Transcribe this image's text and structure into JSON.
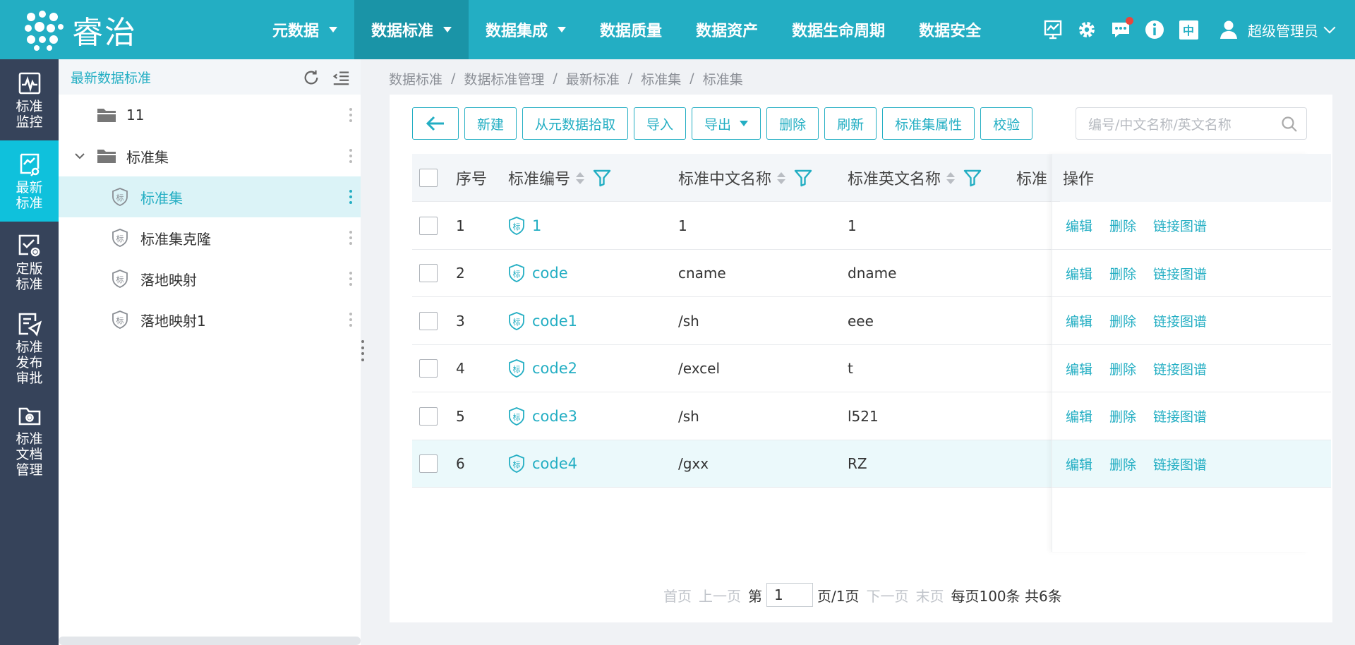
{
  "app": {
    "logo_text": "睿治"
  },
  "nav": [
    {
      "label": "元数据",
      "dropdown": true,
      "active": false
    },
    {
      "label": "数据标准",
      "dropdown": true,
      "active": true
    },
    {
      "label": "数据集成",
      "dropdown": true,
      "active": false
    },
    {
      "label": "数据质量",
      "dropdown": false,
      "active": false
    },
    {
      "label": "数据资产",
      "dropdown": false,
      "active": false
    },
    {
      "label": "数据生命周期",
      "dropdown": false,
      "active": false
    },
    {
      "label": "数据安全",
      "dropdown": false,
      "active": false
    }
  ],
  "tools": {
    "lang": "中",
    "user": "超级管理员"
  },
  "rail": [
    {
      "label": "标准监控",
      "icon": "monitor-pulse-icon",
      "active": false
    },
    {
      "label": "最新标准",
      "icon": "chart-doc-icon",
      "active": true
    },
    {
      "label": "定版标准",
      "icon": "check-gear-icon",
      "active": false
    },
    {
      "label": "标准发布审批",
      "icon": "doc-send-icon",
      "active": false
    },
    {
      "label": "标准文档管理",
      "icon": "folder-gear-icon",
      "active": false
    }
  ],
  "tree": {
    "title": "最新数据标准",
    "nodes": [
      {
        "label": "11",
        "type": "folder"
      },
      {
        "label": "标准集",
        "type": "folder-expanded"
      },
      {
        "label": "标准集",
        "type": "standard",
        "selected": true
      },
      {
        "label": "标准集克隆",
        "type": "standard"
      },
      {
        "label": "落地映射",
        "type": "standard"
      },
      {
        "label": "落地映射1",
        "type": "standard"
      }
    ]
  },
  "breadcrumb": [
    "数据标准",
    "数据标准管理",
    "最新标准",
    "标准集",
    "标准集"
  ],
  "toolbar": {
    "new": "新建",
    "pick": "从元数据拾取",
    "import": "导入",
    "export": "导出",
    "delete": "删除",
    "refresh": "刷新",
    "props": "标准集属性",
    "validate": "校验"
  },
  "search": {
    "placeholder": "编号/中文名称/英文名称"
  },
  "table": {
    "headers": {
      "seq": "序号",
      "code": "标准编号",
      "cname": "标准中文名称",
      "ename": "标准英文名称",
      "more": "标准",
      "ops": "操作"
    },
    "rows": [
      {
        "seq": "1",
        "code": "1",
        "cname": "1",
        "ename": "1"
      },
      {
        "seq": "2",
        "code": "code",
        "cname": "cname",
        "ename": "dname"
      },
      {
        "seq": "3",
        "code": "code1",
        "cname": "/sh",
        "ename": "eee"
      },
      {
        "seq": "4",
        "code": "code2",
        "cname": "/excel",
        "ename": "t"
      },
      {
        "seq": "5",
        "code": "code3",
        "cname": "/sh",
        "ename": "l521"
      },
      {
        "seq": "6",
        "code": "code4",
        "cname": "/gxx",
        "ename": "RZ"
      }
    ],
    "row_actions": {
      "edit": "编辑",
      "delete": "删除",
      "graph": "链接图谱"
    },
    "shield_glyph": "标"
  },
  "pager": {
    "first": "首页",
    "prev": "上一页",
    "page_prefix": "第",
    "page": "1",
    "page_suffix": "页/1页",
    "next": "下一页",
    "last": "末页",
    "summary": "每页100条 共6条"
  },
  "colors": {
    "primary": "#23aec3",
    "nav_active": "#1a94a7",
    "rail": "#36435a",
    "rail_active": "#0fc1dc"
  }
}
